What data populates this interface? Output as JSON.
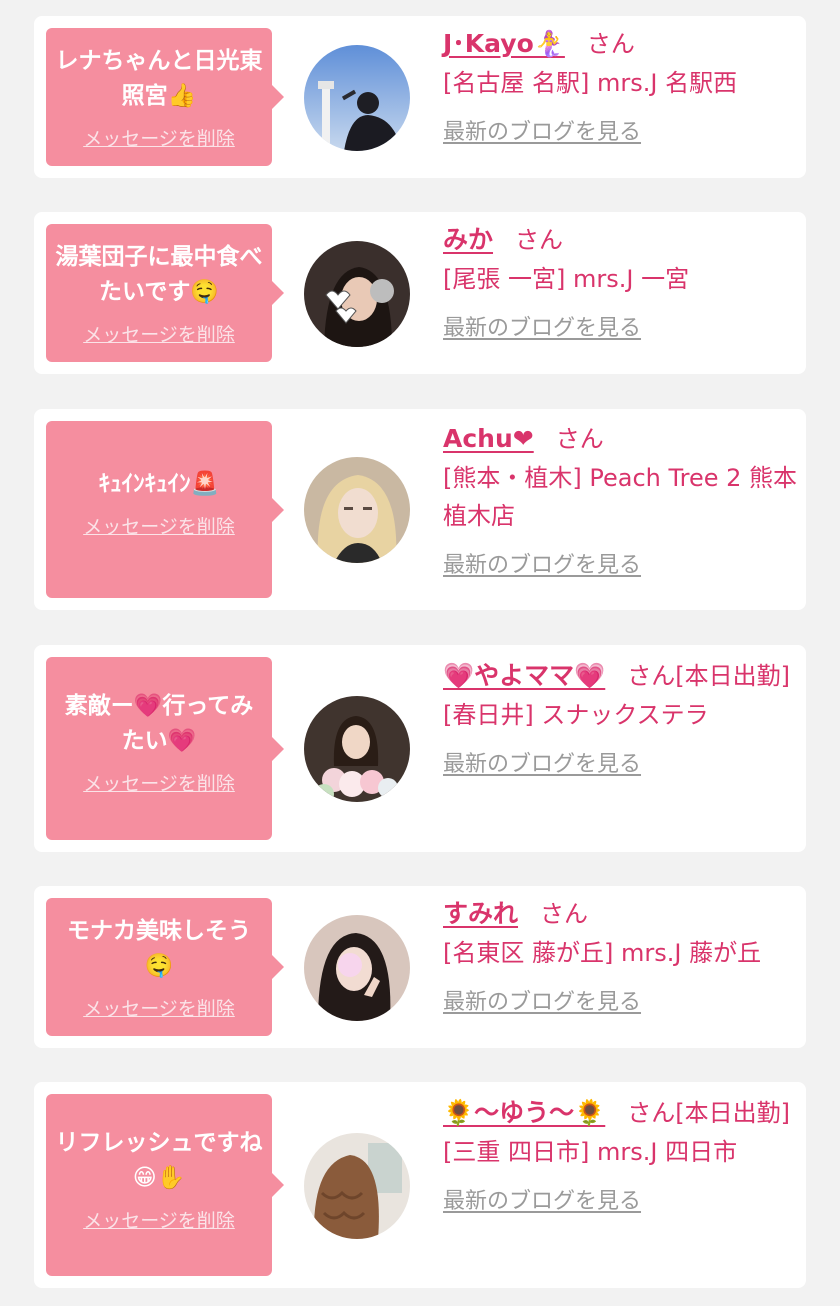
{
  "delete_label": "メッセージを削除",
  "blog_label": "最新のブログを見る",
  "honorific": "さん",
  "cards": [
    {
      "message": "レナちゃんと日光東照宮👍",
      "name": "J･Kayo🧜‍♀️",
      "badge": "",
      "shop": "[名古屋 名駅] mrs.J 名駅西"
    },
    {
      "message": "湯葉団子に最中食べたいです🤤",
      "name": "みか",
      "badge": "",
      "shop": "[尾張 一宮] mrs.J 一宮"
    },
    {
      "message": "ｷｭｲﾝｷｭｲﾝ🚨",
      "name": "Achu❤︎",
      "badge": "",
      "shop": "[熊本・植木] Peach Tree 2 熊本植木店"
    },
    {
      "message": "素敵ー💗行ってみたい💗",
      "name": "💗やよママ💗",
      "badge": "[本日出勤]",
      "shop": "[春日井] スナックステラ"
    },
    {
      "message": "モナカ美味しそう🤤",
      "name": "すみれ",
      "badge": "",
      "shop": "[名東区 藤が丘] mrs.J 藤が丘"
    },
    {
      "message": "リフレッシュですね😁✋",
      "name": "🌻〜ゆう〜🌻",
      "badge": "[本日出勤]",
      "shop": "[三重 四日市] mrs.J 四日市"
    }
  ]
}
